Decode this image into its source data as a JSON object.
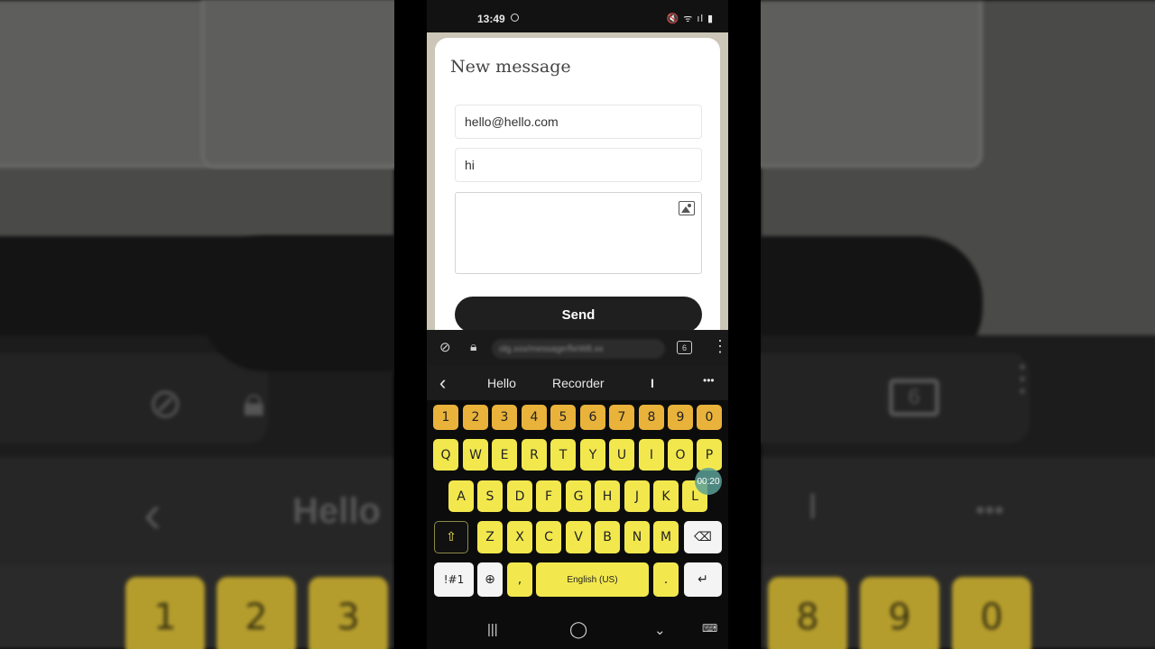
{
  "status": {
    "time": "13:49",
    "icons": "🔇 ᯤ ıl ▮"
  },
  "dialog": {
    "title": "New message",
    "to_value": "hello@hello.com",
    "subject_value": "hi",
    "body_value": "",
    "send_label": "Send"
  },
  "browser": {
    "url_text": "olg.xxx/message/fieW8.xx",
    "tabs_count": "6"
  },
  "suggestions": {
    "items": [
      "Hello",
      "Recorder",
      "I"
    ],
    "more": "•••",
    "back": "‹"
  },
  "keyboard": {
    "numbers": [
      "1",
      "2",
      "3",
      "4",
      "5",
      "6",
      "7",
      "8",
      "9",
      "0"
    ],
    "row1": [
      "Q",
      "W",
      "E",
      "R",
      "T",
      "Y",
      "U",
      "I",
      "O",
      "P"
    ],
    "row2": [
      "A",
      "S",
      "D",
      "F",
      "G",
      "H",
      "J",
      "K",
      "L"
    ],
    "row3": [
      "Z",
      "X",
      "C",
      "V",
      "B",
      "N",
      "M"
    ],
    "symbols_label": "!#1",
    "comma": ",",
    "space_label": "English (US)",
    "period": ".",
    "timer": "00:20"
  },
  "background": {
    "suggest_word": "Hello",
    "numbers_left": [
      "1",
      "2",
      "3"
    ],
    "numbers_right": [
      "8",
      "9",
      "0"
    ],
    "tabs_count": "6"
  },
  "colors": {
    "key_yellow": "#f2e84e",
    "key_orange": "#e9b23a",
    "send_button": "#1f1f1f",
    "dialog_bg": "#ffffff"
  }
}
